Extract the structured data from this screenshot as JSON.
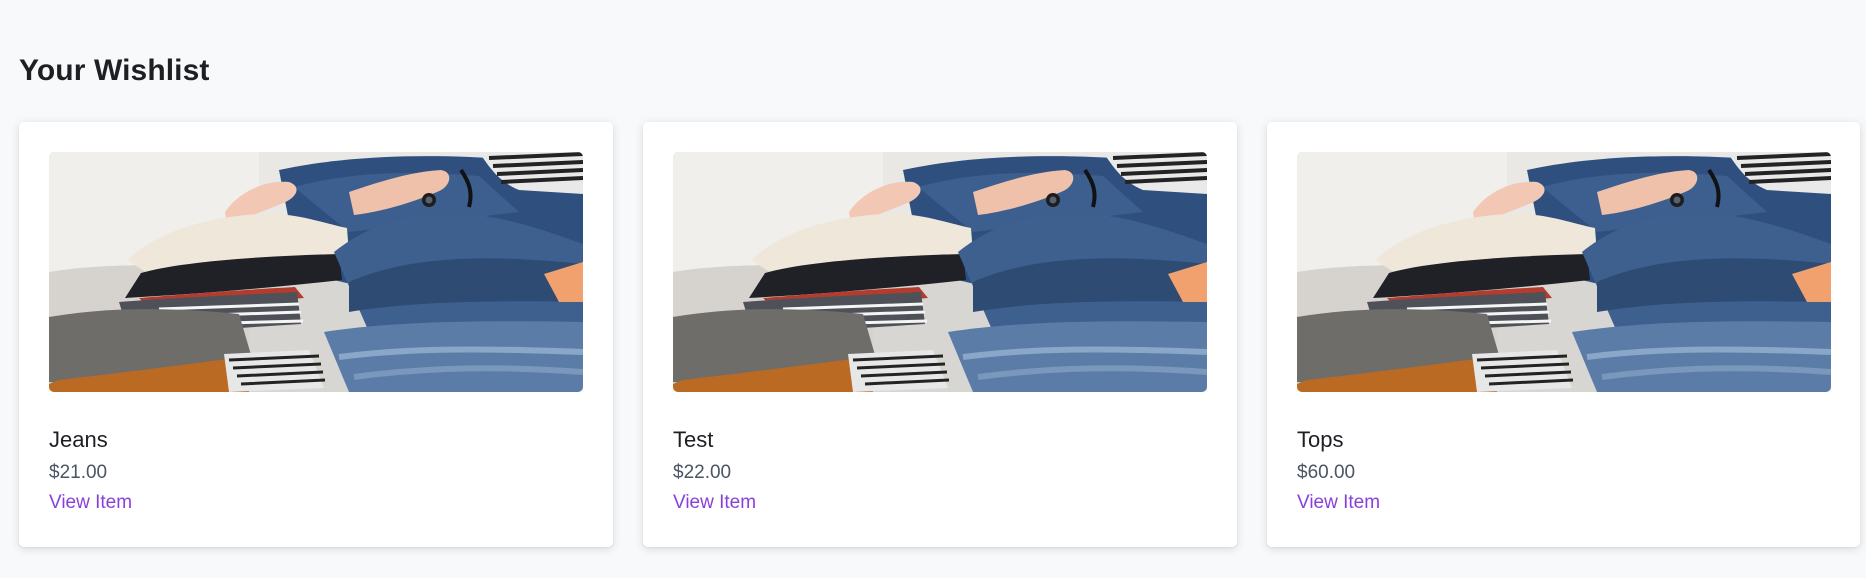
{
  "page": {
    "title": "Your Wishlist"
  },
  "wishlist": {
    "items": [
      {
        "name": "Jeans",
        "price": "$21.00",
        "link_label": "View Item"
      },
      {
        "name": "Test",
        "price": "$22.00",
        "link_label": "View Item"
      },
      {
        "name": "Tops",
        "price": "$60.00",
        "link_label": "View Item"
      }
    ]
  },
  "colors": {
    "background": "#f8f9fb",
    "card": "#ffffff",
    "link": "#8b3fd9",
    "price": "#4b5563",
    "heading": "#1d1f23"
  }
}
